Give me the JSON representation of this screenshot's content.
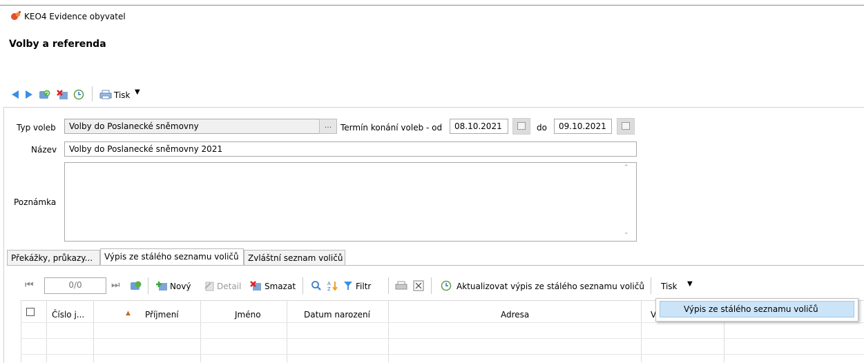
{
  "app": {
    "title": "KEO4 Evidence obyvatel",
    "page_title": "Volby a referenda"
  },
  "toolbar": {
    "icons": [
      "back-icon",
      "forward-icon",
      "refresh-icon",
      "delete-icon",
      "history-icon",
      "print-icon"
    ],
    "print_label": "Tisk"
  },
  "form": {
    "typ_voleb_label": "Typ voleb",
    "typ_voleb_value": "Volby do Poslanecké sněmovny",
    "ellipsis": "...",
    "termin_label": "Termín konání voleb - od",
    "date_from": "08.10.2021",
    "do_label": "do",
    "date_to": "09.10.2021",
    "nazev_label": "Název",
    "nazev_value": "Volby do Poslanecké sněmovny 2021",
    "poznamka_label": "Poznámka",
    "poznamka_value": ""
  },
  "tabs": [
    {
      "label": "Překážky, průkazy..."
    },
    {
      "label": "Výpis ze stálého seznamu voličů"
    },
    {
      "label": "Zvláštní seznam voličů"
    }
  ],
  "subtoolbar": {
    "record_counter": "0/0",
    "new_label": "Nový",
    "detail_label": "Detail",
    "delete_label": "Smazat",
    "filter_label": "Filtr",
    "update_label": "Aktualizovat výpis ze stálého seznamu voličů",
    "print_label": "Tisk"
  },
  "table": {
    "columns": [
      "Číslo j...",
      "Příjmení",
      "Jméno",
      "Datum narození",
      "Adresa",
      "V"
    ],
    "sort_column": "Příjmení",
    "rows": []
  },
  "dropdown_menu": {
    "items": [
      "Výpis ze stálého seznamu voličů"
    ]
  },
  "colors": {
    "accent_blue": "#2f7fd4",
    "menu_highlight": "#cce4f7"
  }
}
